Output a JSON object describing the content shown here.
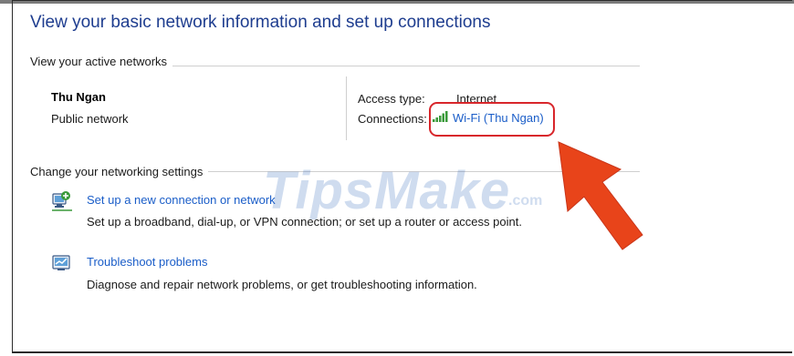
{
  "header": {
    "title": "View your basic network information and set up connections"
  },
  "active_networks": {
    "section_label": "View your active networks",
    "network_name": "Thu Ngan",
    "network_type": "Public network",
    "access_type_label": "Access type:",
    "access_type_value": "Internet",
    "connections_label": "Connections:",
    "connection_link": "Wi-Fi (Thu Ngan)",
    "connection_icon": "wifi-signal-icon"
  },
  "settings": {
    "section_label": "Change your networking settings",
    "tasks": [
      {
        "link": "Set up a new connection or network",
        "description": "Set up a broadband, dial-up, or VPN connection; or set up a router or access point.",
        "icon": "network-setup-icon"
      },
      {
        "link": "Troubleshoot problems",
        "description": "Diagnose and repair network problems, or get troubleshooting information.",
        "icon": "troubleshoot-icon"
      }
    ]
  },
  "watermark": {
    "text": "TipsMake",
    "suffix": ".com"
  },
  "colors": {
    "title": "#1e3d8f",
    "link": "#1a5dc8",
    "highlight": "#d8262b",
    "arrow": "#e8441a"
  }
}
